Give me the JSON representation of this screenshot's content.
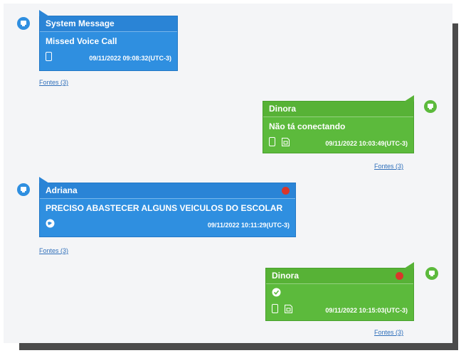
{
  "colors": {
    "incoming": "#2f8fe0",
    "outgoing": "#5cba3c",
    "unread_dot": "#d9362b",
    "link": "#2f6fba"
  },
  "messages": [
    {
      "direction": "incoming",
      "sender": "System Message",
      "text": "Missed Voice Call",
      "timestamp": "09/11/2022 09:08:32(UTC-3)",
      "fontes_label": "Fontes (3)",
      "icons": [
        "phone-icon"
      ]
    },
    {
      "direction": "outgoing",
      "sender": "Dinora",
      "text": "Não tá conectando",
      "timestamp": "09/11/2022 10:03:49(UTC-3)",
      "fontes_label": "Fontes (3)",
      "icons": [
        "phone-icon",
        "sim-card-icon"
      ]
    },
    {
      "direction": "incoming",
      "sender": "Adriana",
      "text": "PRECISO ABASTECER ALGUNS VEICULOS DO ESCOLAR",
      "timestamp": "09/11/2022 10:11:29(UTC-3)",
      "fontes_label": "Fontes (3)",
      "icons": [
        "globe-icon"
      ],
      "unread": true
    },
    {
      "direction": "outgoing",
      "sender": "Dinora",
      "text": "",
      "timestamp": "09/11/2022 10:15:03(UTC-3)",
      "fontes_label": "Fontes (3)",
      "icons": [
        "check-badge-icon",
        "phone-icon",
        "sim-card-icon"
      ],
      "unread": true
    }
  ]
}
